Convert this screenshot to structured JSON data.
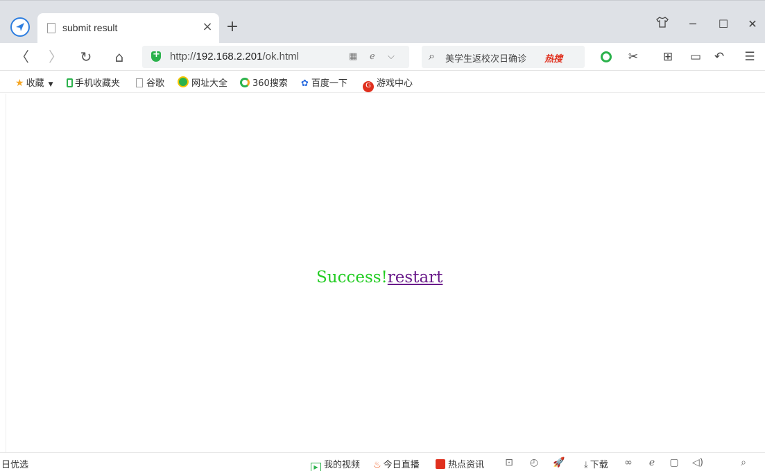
{
  "browser": {
    "tab": {
      "title": "submit result",
      "close": "×"
    },
    "new_tab": "+",
    "window_controls": {
      "skin": "👕",
      "minimize": "─",
      "maximize": "☐",
      "close": "✕"
    }
  },
  "navbar": {
    "back": "〈",
    "forward": "〉",
    "reload": "↻",
    "home": "⌂",
    "url_prefix": "http://",
    "url_host": "192.168.2.201",
    "url_path": "/ok.html",
    "search_text": "美学生返校次日确诊",
    "search_hot": "热搜",
    "tools": {
      "cut": "✂",
      "apps": "⊞",
      "battery": "▭",
      "undo": "↶",
      "menu": "☰"
    }
  },
  "bookmarks": [
    {
      "label": "收藏",
      "icon": "star-icon",
      "color": "#f5a623"
    },
    {
      "label": "手机收藏夹",
      "icon": "phone-icon",
      "color": "#2bb24c"
    },
    {
      "label": "谷歌",
      "icon": "page-icon",
      "color": "#999999"
    },
    {
      "label": "网址大全",
      "icon": "globe-icon",
      "color": "#2bb24c"
    },
    {
      "label": "360搜索",
      "icon": "search360-icon",
      "color": "#f5a623"
    },
    {
      "label": "百度一下",
      "icon": "paw-icon",
      "color": "#2f6fe0"
    },
    {
      "label": "游戏中心",
      "icon": "game-icon",
      "color": "#e0301e"
    }
  ],
  "page": {
    "success_text": "Success!",
    "restart_link": "restart",
    "success_color": "#22cc22",
    "link_color": "#6a1b8a"
  },
  "statusbar": {
    "left_text": "日优选",
    "video": "我的视频",
    "live": "今日直播",
    "news": "热点资讯",
    "download": "下载"
  }
}
